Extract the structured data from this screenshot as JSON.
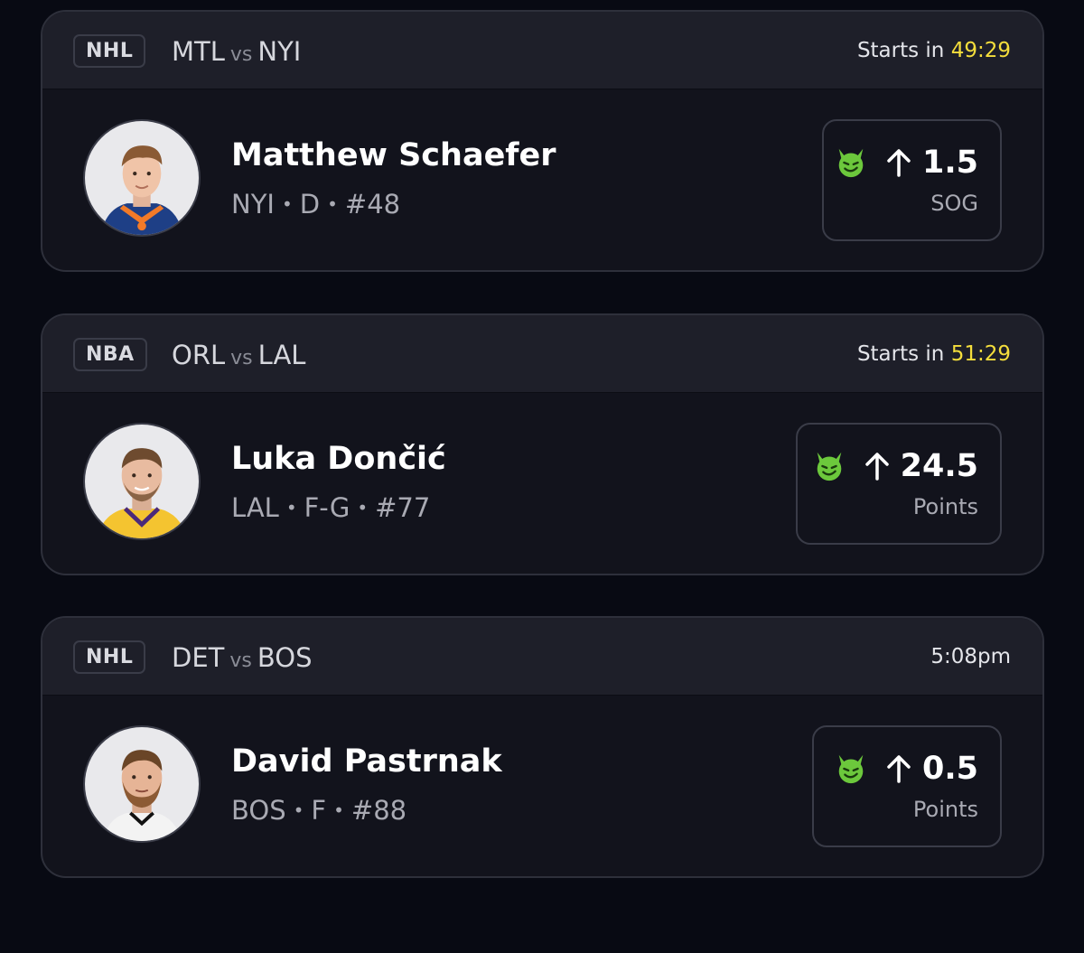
{
  "colors": {
    "background": "#080a13",
    "card": "#12131c",
    "header": "#1e1f29",
    "countdown": "#f5de3c",
    "demon": "#6cc83c"
  },
  "cards": [
    {
      "league": "NHL",
      "away": "MTL",
      "vs": "vs",
      "home": "NYI",
      "start_prefix": "Starts in",
      "countdown": "49:29",
      "start_time": "",
      "player": {
        "name": "Matthew Schaefer",
        "team": "NYI",
        "position": "D",
        "number": "#48",
        "avatar": "hockey-jersey-avatar"
      },
      "pick": {
        "icon": "demon-icon",
        "direction": "arrow-up-icon",
        "line": "1.5",
        "stat": "SOG"
      }
    },
    {
      "league": "NBA",
      "away": "ORL",
      "vs": "vs",
      "home": "LAL",
      "start_prefix": "Starts in",
      "countdown": "51:29",
      "start_time": "",
      "player": {
        "name": "Luka Dončić",
        "team": "LAL",
        "position": "F-G",
        "number": "#77",
        "avatar": "basketball-jersey-avatar"
      },
      "pick": {
        "icon": "demon-icon",
        "direction": "arrow-up-icon",
        "line": "24.5",
        "stat": "Points"
      }
    },
    {
      "league": "NHL",
      "away": "DET",
      "vs": "vs",
      "home": "BOS",
      "start_prefix": "",
      "countdown": "",
      "start_time": "5:08pm",
      "player": {
        "name": "David Pastrnak",
        "team": "BOS",
        "position": "F",
        "number": "#88",
        "avatar": "player-headshot-avatar"
      },
      "pick": {
        "icon": "demon-icon",
        "direction": "arrow-up-icon",
        "line": "0.5",
        "stat": "Points"
      }
    }
  ]
}
